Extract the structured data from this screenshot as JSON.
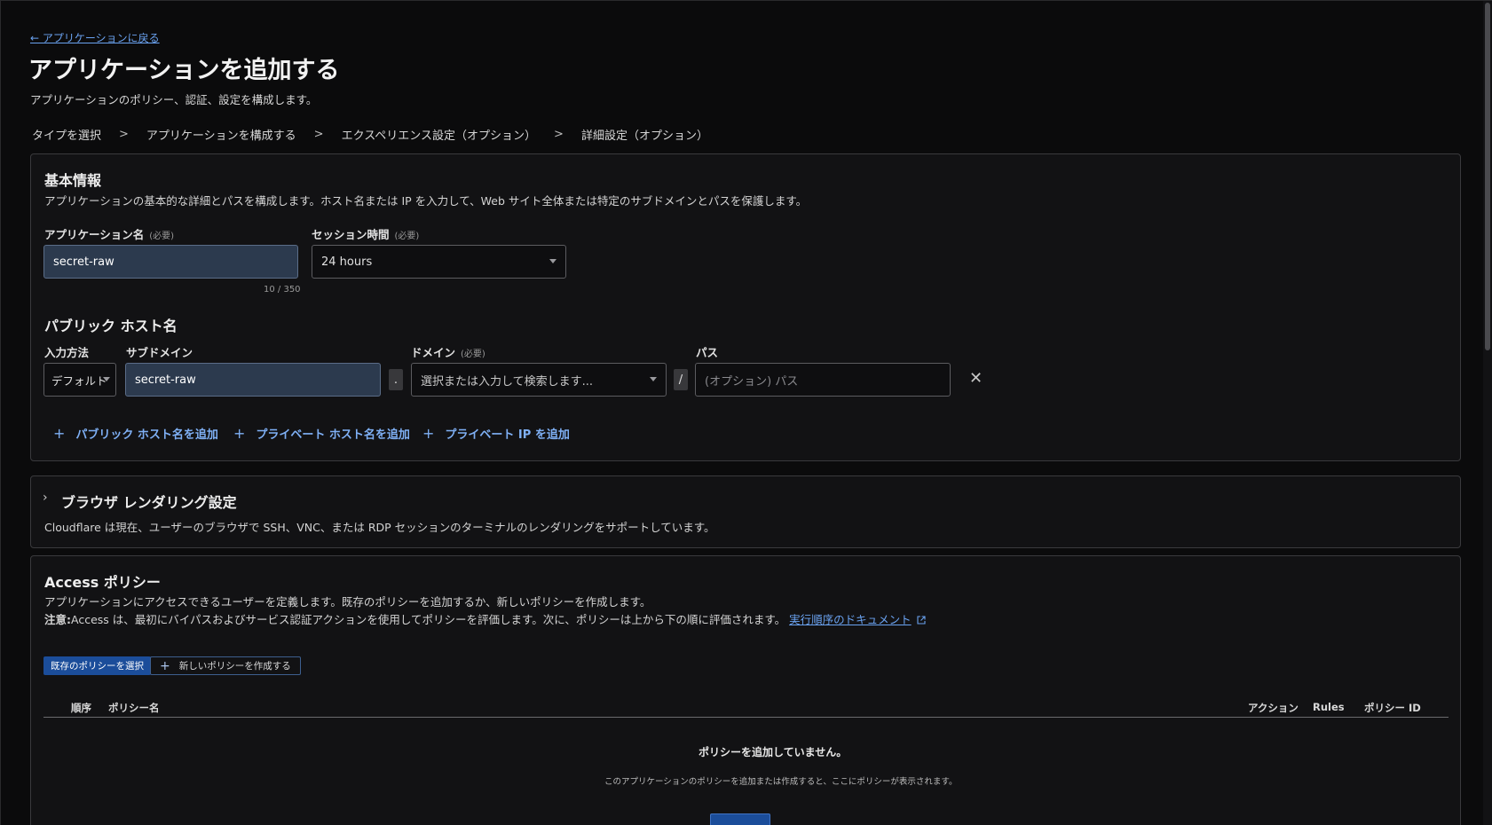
{
  "nav": {
    "back_label": "← アプリケーションに戻る"
  },
  "page": {
    "title": "アプリケーションを追加する",
    "subtitle": "アプリケーションのポリシー、認証、設定を構成します。"
  },
  "steps": [
    {
      "label": "タイプを選択"
    },
    {
      "label": "アプリケーションを構成する"
    },
    {
      "label": "エクスペリエンス設定（オプション）"
    },
    {
      "label": "詳細設定（オプション）"
    }
  ],
  "step_separator": ">",
  "basic": {
    "title": "基本情報",
    "description": "アプリケーションの基本的な詳細とパスを構成します。ホスト名または IP を入力して、Web サイト全体または特定のサブドメインとパスを保護します。",
    "app_name_label": "アプリケーション名",
    "required_tag": "(必要)",
    "app_name_value": "secret-raw",
    "app_name_counter": "10 / 350",
    "session_label": "セッション時間",
    "session_value": "24 hours"
  },
  "hostname": {
    "title": "パブリック ホスト名",
    "input_method_label": "入力方法",
    "input_method_value": "デフォルト",
    "subdomain_label": "サブドメイン",
    "subdomain_value": "secret-raw",
    "dot": ".",
    "domain_label": "ドメイン",
    "domain_placeholder": "選択または入力して検索します...",
    "slash": "/",
    "path_label": "パス",
    "path_placeholder": "(オプション) パス",
    "close_glyph": "✕",
    "add_public": "パブリック ホスト名を追加",
    "add_private_host": "プライベート ホスト名を追加",
    "add_private_ip": "プライベート IP を追加",
    "plus_glyph": "+"
  },
  "browser": {
    "chevron": "›",
    "title": "ブラウザ レンダリング設定",
    "description": "Cloudflare は現在、ユーザーのブラウザで SSH、VNC、または RDP セッションのターミナルのレンダリングをサポートしています。"
  },
  "access": {
    "title": "Access ポリシー",
    "description": "アプリケーションにアクセスできるユーザーを定義します。既存のポリシーを追加するか、新しいポリシーを作成します。",
    "note_prefix": "注意:",
    "note_text": "Access は、最初にバイパスおよびサービス認証アクションを使用してポリシーを評価します。次に、ポリシーは上から下の順に評価されます。",
    "note_link": "実行順序のドキュメント",
    "select_existing": "既存のポリシーを選択",
    "create_new": "新しいポリシーを作成する",
    "columns": {
      "order": "順序",
      "name": "ポリシー名",
      "action": "アクション",
      "rules": "Rules",
      "policy_id": "ポリシー ID"
    },
    "empty_title": "ポリシーを追加していません。",
    "empty_sub": "このアプリケーションのポリシーを追加または作成すると、ここにポリシーが表示されます。"
  }
}
